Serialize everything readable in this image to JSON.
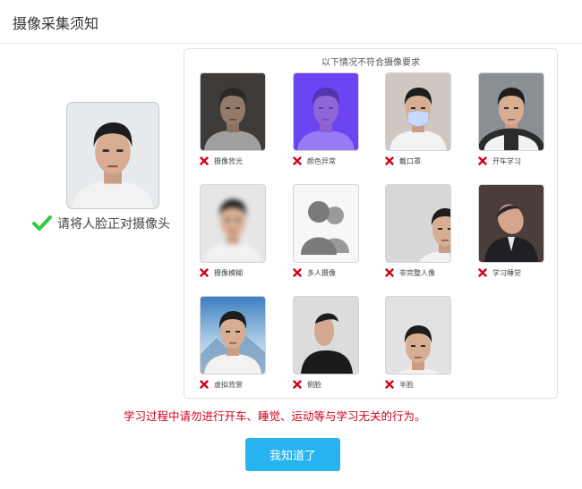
{
  "dialog": {
    "title": "摄像采集须知"
  },
  "correct_example": {
    "label": "请将人脸正对摄像头"
  },
  "panel": {
    "title": "以下情况不符合摄像要求",
    "items": [
      {
        "label": "摄像背光"
      },
      {
        "label": "颜色异常"
      },
      {
        "label": "戴口罩"
      },
      {
        "label": "开车学习"
      },
      {
        "label": "摄像模糊"
      },
      {
        "label": "多人摄像"
      },
      {
        "label": "非完整人像"
      },
      {
        "label": "学习睡觉"
      },
      {
        "label": "虚拟背景"
      },
      {
        "label": "侧脸"
      },
      {
        "label": "半脸"
      }
    ]
  },
  "warning": "学习过程中请勿进行开车、睡觉、运动等与学习无关的行为。",
  "buttons": {
    "ok_label": "我知道了"
  },
  "colors": {
    "accent": "#27b4f0",
    "error": "#d0021b",
    "success": "#2ecc40"
  }
}
